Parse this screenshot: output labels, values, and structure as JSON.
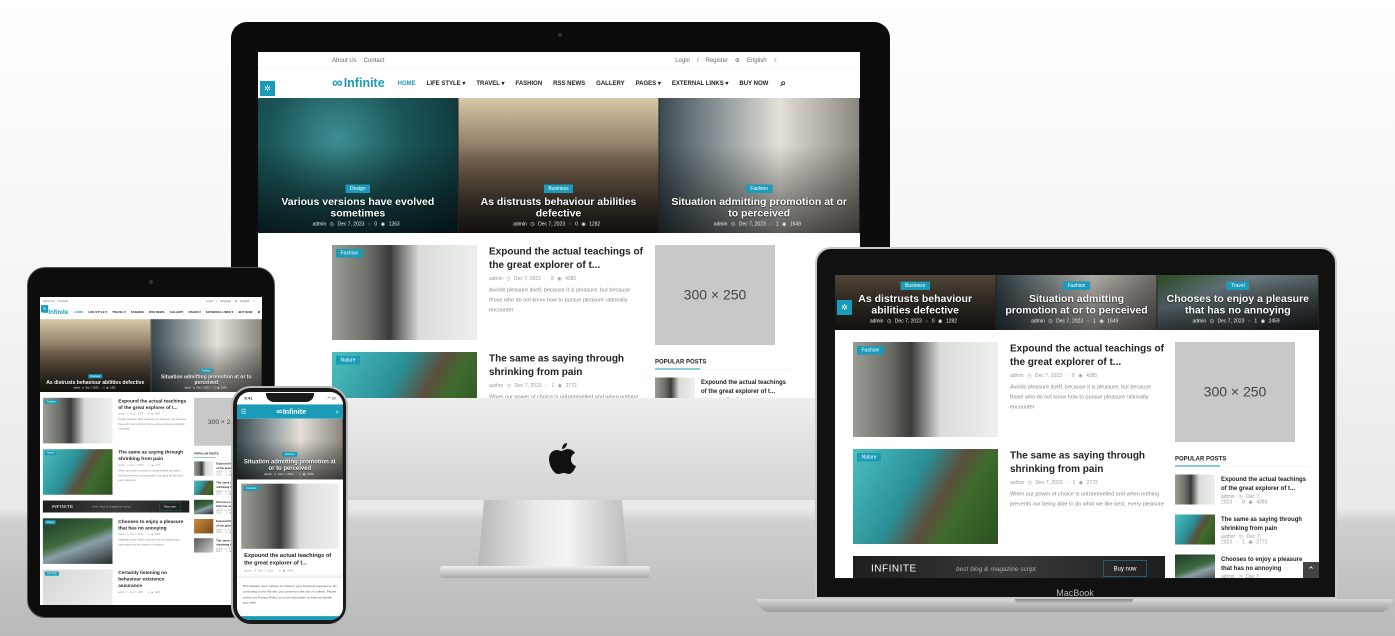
{
  "site": {
    "top_links": [
      "About Us",
      "Contact"
    ],
    "login": "Login",
    "separator": "/",
    "register": "Register",
    "language": "English",
    "logo": "Infinite",
    "nav": [
      {
        "label": "HOME",
        "dropdown": false,
        "active": true
      },
      {
        "label": "LIFE STYLE",
        "dropdown": true
      },
      {
        "label": "TRAVEL",
        "dropdown": true
      },
      {
        "label": "FASHION",
        "dropdown": false
      },
      {
        "label": "RSS NEWS",
        "dropdown": false
      },
      {
        "label": "GALLERY",
        "dropdown": false
      },
      {
        "label": "PAGES",
        "dropdown": true
      },
      {
        "label": "EXTERNAL LINKS",
        "dropdown": true
      },
      {
        "label": "BUY NOW",
        "dropdown": false
      }
    ],
    "accent_color": "#1a9bb8",
    "slides": [
      {
        "category": "Design",
        "title": "Various versions have evolved sometimes",
        "author": "admin",
        "date": "Dec 7, 2023",
        "comments": "0",
        "views": "1263"
      },
      {
        "category": "Business",
        "title": "As distrusts behaviour abilities defective",
        "author": "admin",
        "date": "Dec 7, 2023",
        "comments": "0",
        "views": "1282"
      },
      {
        "category": "Fashion",
        "title": "Situation admitting promotion at or to perceived",
        "author": "admin",
        "date": "Dec 7, 2023",
        "comments": "1",
        "views": "1649"
      },
      {
        "category": "Travel",
        "title": "Chooses to enjoy a pleasure that has no annoying",
        "author": "admin",
        "date": "Dec 7, 2023",
        "comments": "1",
        "views": "2459"
      }
    ],
    "posts": [
      {
        "category": "Fashion",
        "title": "Expound the actual teachings of the great explorer of t...",
        "author": "admin",
        "date": "Dec 7, 2023",
        "comments": "8",
        "views": "4385",
        "excerpt": "Avoids pleasure itself, because it is pleasure, but because those who do not know how to pursue pleasure rationally encounter"
      },
      {
        "category": "Nature",
        "title": "The same as saying through shrinking from pain",
        "author": "author",
        "date": "Dec 7, 2023",
        "comments": "1",
        "views": "2772",
        "excerpt": "When our power of choice is untrammelled and when nothing prevents our being able to do what we like best, every pleasure"
      },
      {
        "category": "Travel",
        "title": "Chooses to enjoy a pleasure that has no annoying",
        "author": "admin",
        "date": "Dec 7, 2023",
        "comments": "1",
        "views": "2459",
        "excerpt": "Indignation and dislike men who are so beguiled and demoralized by the charms of pleasure"
      },
      {
        "category": "Life Style",
        "title": "Certainly listening no behaviour existence assurance",
        "author": "admin",
        "date": "Dec 7, 2023",
        "comments": "0",
        "views": "1180",
        "excerpt": ""
      }
    ],
    "ad_label": "300 × 250",
    "popular_title": "POPULAR POSTS",
    "banner": {
      "brand": "INFINITE",
      "tagline": "best blog & magazine script",
      "button": "Buy now"
    },
    "cookie_text": "This website uses cookies to enhance your browsing experience. By continuing to use the site, you consent to the use of cookies. Please review our Privacy Policy for more information on how we handle your data."
  },
  "devices": {
    "laptop_label": "MacBook",
    "phone_time": "9:41"
  }
}
